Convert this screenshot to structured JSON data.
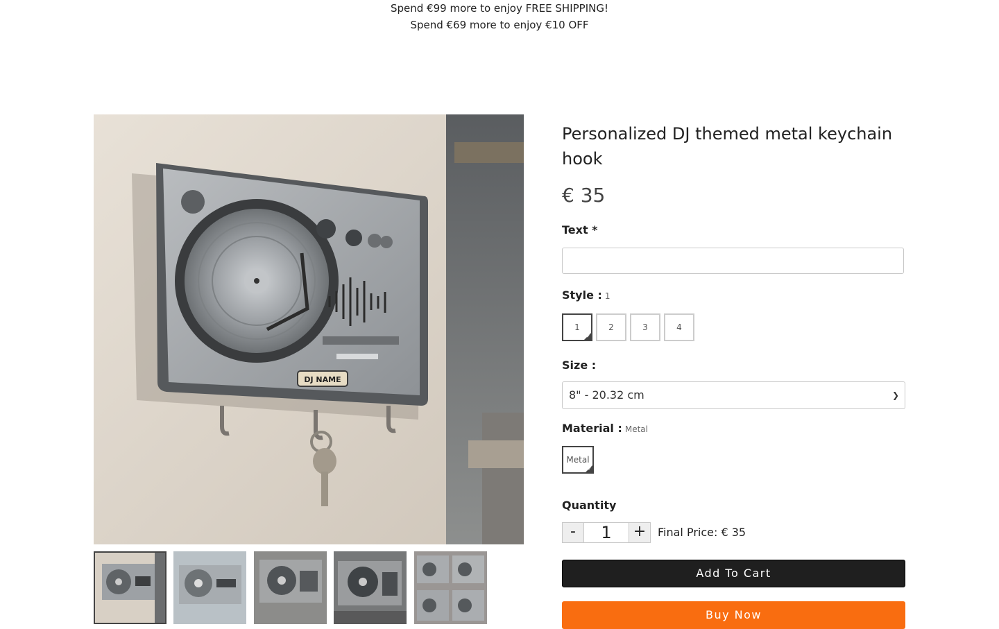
{
  "promo": {
    "line1": "Spend €99 more to enjoy FREE SHIPPING!",
    "line2": "Spend €69 more to enjoy €10 OFF"
  },
  "product": {
    "title": "Personalized DJ themed metal keychain hook",
    "price": "€ 35",
    "image_nameplate": "DJ NAME"
  },
  "text_option": {
    "label": "Text *",
    "value": ""
  },
  "style_option": {
    "label": "Style :",
    "selected": "1",
    "options": [
      "1",
      "2",
      "3",
      "4"
    ]
  },
  "size_option": {
    "label": "Size :",
    "selected": "8\" - 20.32 cm"
  },
  "material_option": {
    "label": "Material :",
    "selected": "Metal",
    "options": [
      "Metal"
    ]
  },
  "quantity": {
    "label": "Quantity",
    "minus": "-",
    "value": "1",
    "plus": "+"
  },
  "final_price": "Final Price: € 35",
  "buttons": {
    "add_to_cart": "Add To Cart",
    "buy_now": "Buy Now"
  },
  "colors": {
    "buy_now": "#f96d10",
    "add_to_cart": "#1f1f1f"
  }
}
